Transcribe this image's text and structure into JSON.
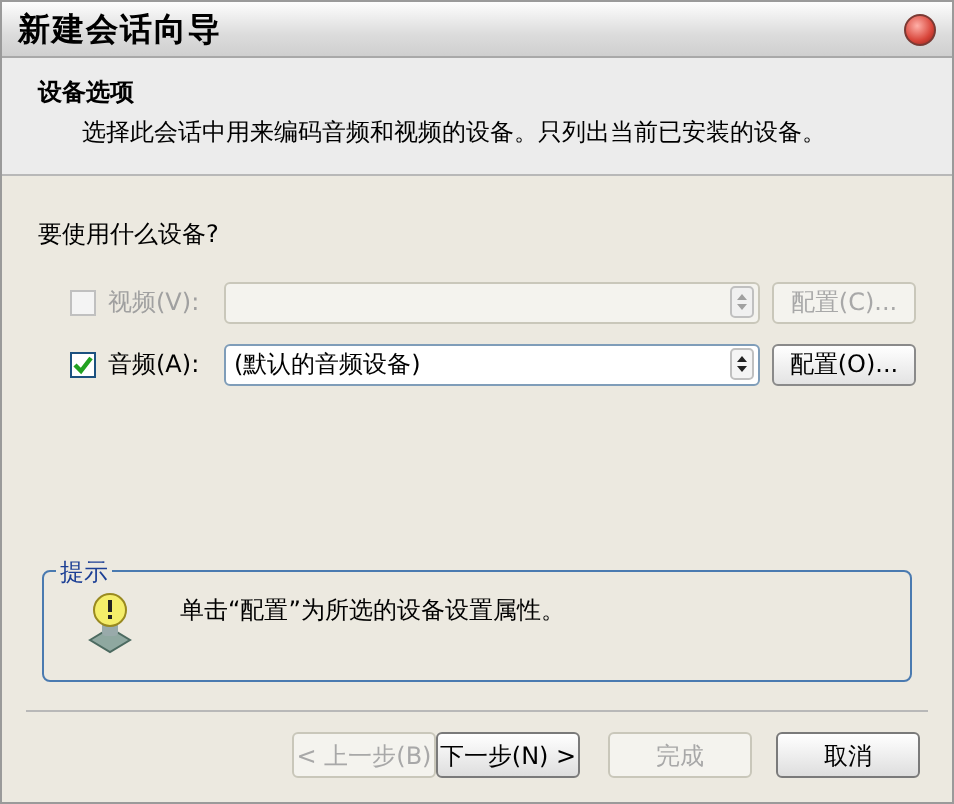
{
  "window": {
    "title": "新建会话向导"
  },
  "header": {
    "title": "设备选项",
    "subtitle": "选择此会话中用来编码音频和视频的设备。只列出当前已安装的设备。"
  },
  "question": "要使用什么设备?",
  "devices": [
    {
      "label": "视频(V):",
      "checked": false,
      "disabled": true,
      "button": "配置(C)..."
    },
    {
      "label": "音频(A):",
      "checked": true,
      "disabled": false,
      "value": "(默认的音频设备)",
      "button": "配置(O)..."
    }
  ],
  "tip": {
    "title": "提示",
    "text": "单击“配置”为所选的设备设置属性。"
  },
  "buttons": [
    {
      "label": "< 上一步(B)",
      "disabled": true
    },
    {
      "label": "下一步(N) >",
      "disabled": false
    },
    {
      "label": "完成",
      "disabled": true
    },
    {
      "label": "取消",
      "disabled": false
    }
  ]
}
